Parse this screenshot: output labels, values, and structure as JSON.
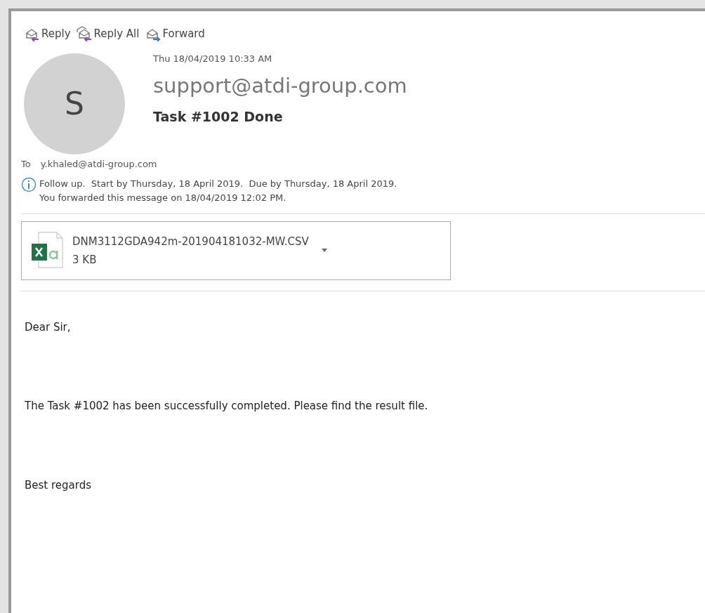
{
  "toolbar": [
    {
      "kind": "reply",
      "label": "Reply"
    },
    {
      "kind": "reply_all",
      "label": "Reply All"
    },
    {
      "kind": "forward",
      "label": "Forward"
    }
  ],
  "header": {
    "avatar_initial": "S",
    "date": "Thu 18/04/2019 10:33 AM",
    "sender": "support@atdi-group.com",
    "subject": "Task #1002 Done",
    "to_label": "To",
    "to": "y.khaled@atdi-group.com"
  },
  "info": [
    "Follow up.  Start by Thursday, 18 April 2019.  Due by Thursday, 18 April 2019.",
    "You forwarded this message on 18/04/2019 12:02 PM."
  ],
  "attachment": {
    "name": "DNM3112GDA942m-201904181032-MW.CSV",
    "size": "3 KB"
  },
  "body": [
    "Dear Sir,",
    "The Task #1002 has been successfully completed. Please find the result file.",
    "Best regards"
  ]
}
